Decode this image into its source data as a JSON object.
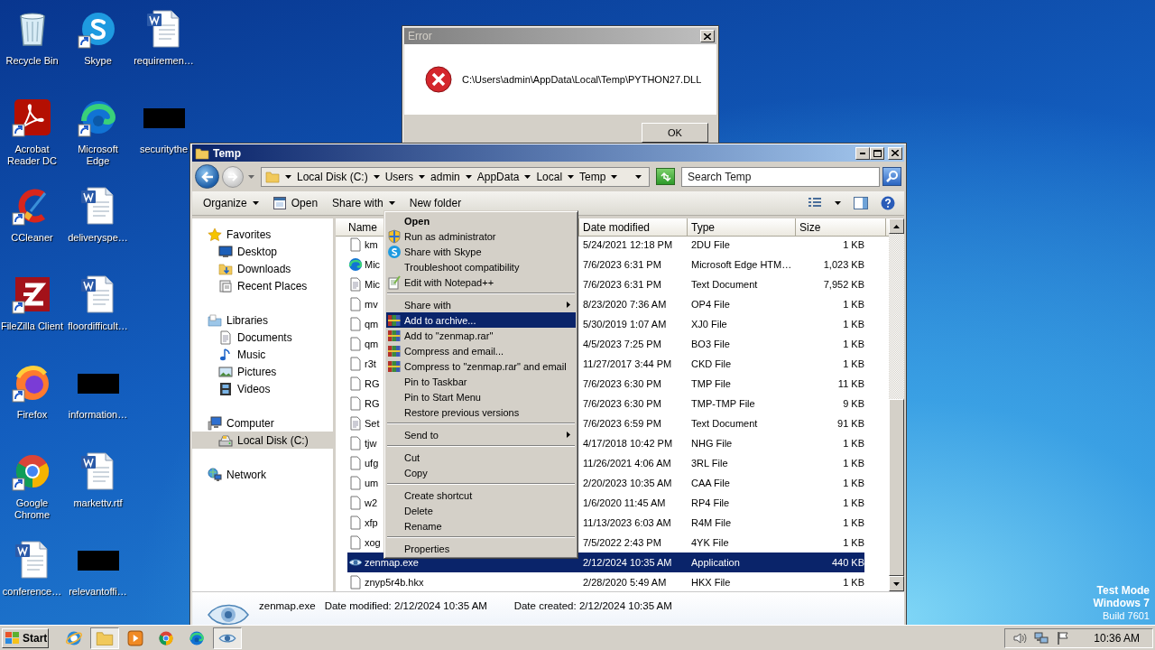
{
  "desktop": {
    "icons": [
      {
        "label": "Recycle Bin",
        "kind": "recycle",
        "shortcut": false
      },
      {
        "label": "Acrobat Reader DC",
        "kind": "acrobat",
        "shortcut": true
      },
      {
        "label": "CCleaner",
        "kind": "ccleaner",
        "shortcut": true
      },
      {
        "label": "FileZilla Client",
        "kind": "filezilla",
        "shortcut": true
      },
      {
        "label": "Firefox",
        "kind": "firefox",
        "shortcut": true
      },
      {
        "label": "Google Chrome",
        "kind": "chrome",
        "shortcut": true
      },
      {
        "label": "conference…",
        "kind": "word",
        "shortcut": false
      },
      {
        "label": "Skype",
        "kind": "skype",
        "shortcut": true
      },
      {
        "label": "Microsoft Edge",
        "kind": "edge",
        "shortcut": true
      },
      {
        "label": "deliveryspe…",
        "kind": "word",
        "shortcut": false
      },
      {
        "label": "floordifficult…",
        "kind": "word",
        "shortcut": false
      },
      {
        "label": "information…",
        "kind": "thumb",
        "shortcut": false
      },
      {
        "label": "markettv.rtf",
        "kind": "word",
        "shortcut": false
      },
      {
        "label": "relevantoffi…",
        "kind": "thumb",
        "shortcut": false
      },
      {
        "label": "requiremen…",
        "kind": "word",
        "shortcut": false
      },
      {
        "label": "securitythe",
        "kind": "thumb",
        "shortcut": false
      }
    ]
  },
  "error_dialog": {
    "title": "Error",
    "message": "C:\\Users\\admin\\AppData\\Local\\Temp\\PYTHON27.DLL",
    "button": "OK"
  },
  "explorer": {
    "title": "Temp",
    "address": [
      "Local Disk (C:)",
      "Users",
      "admin",
      "AppData",
      "Local",
      "Temp"
    ],
    "search": {
      "placeholder": "Search Temp"
    },
    "toolbar": [
      {
        "label": "Organize",
        "kind": "dropdown"
      },
      {
        "label": "Open",
        "kind": "icon"
      },
      {
        "label": "Share with",
        "kind": "dropdown"
      },
      {
        "label": "New folder",
        "kind": "plain"
      }
    ],
    "nav": [
      {
        "label": "Favorites",
        "kind": "star",
        "selected": false,
        "children": [
          {
            "label": "Desktop",
            "kind": "desktop",
            "selected": false
          },
          {
            "label": "Downloads",
            "kind": "downloads",
            "selected": false
          },
          {
            "label": "Recent Places",
            "kind": "recent",
            "selected": false
          }
        ]
      },
      {
        "label": "Libraries",
        "kind": "library",
        "selected": false,
        "children": [
          {
            "label": "Documents",
            "kind": "doc",
            "selected": false
          },
          {
            "label": "Music",
            "kind": "music",
            "selected": false
          },
          {
            "label": "Pictures",
            "kind": "pictures",
            "selected": false
          },
          {
            "label": "Videos",
            "kind": "videos",
            "selected": false
          }
        ]
      },
      {
        "label": "Computer",
        "kind": "computer",
        "selected": false,
        "children": [
          {
            "label": "Local Disk (C:)",
            "kind": "disk",
            "selected": true
          }
        ]
      },
      {
        "label": "Network",
        "kind": "network",
        "selected": false
      }
    ],
    "columns": [
      "Name",
      "Date modified",
      "Type",
      "Size"
    ],
    "files": [
      {
        "name": "km",
        "kind": "blank",
        "date": "5/24/2021 12:18 PM",
        "type": "2DU File",
        "size": "1 KB",
        "selected": false
      },
      {
        "name": "Mic",
        "kind": "edge",
        "date": "7/6/2023 6:31 PM",
        "type": "Microsoft Edge HTM…",
        "size": "1,023 KB",
        "selected": false
      },
      {
        "name": "Mic",
        "kind": "text",
        "date": "7/6/2023 6:31 PM",
        "type": "Text Document",
        "size": "7,952 KB",
        "selected": false
      },
      {
        "name": "mv",
        "kind": "blank",
        "date": "8/23/2020 7:36 AM",
        "type": "OP4 File",
        "size": "1 KB",
        "selected": false
      },
      {
        "name": "qm",
        "kind": "blank",
        "date": "5/30/2019 1:07 AM",
        "type": "XJ0 File",
        "size": "1 KB",
        "selected": false
      },
      {
        "name": "qm",
        "kind": "blank",
        "date": "4/5/2023 7:25 PM",
        "type": "BO3 File",
        "size": "1 KB",
        "selected": false
      },
      {
        "name": "r3t",
        "kind": "blank",
        "date": "11/27/2017 3:44 PM",
        "type": "CKD File",
        "size": "1 KB",
        "selected": false
      },
      {
        "name": "RG",
        "kind": "blank",
        "date": "7/6/2023 6:30 PM",
        "type": "TMP File",
        "size": "11 KB",
        "selected": false
      },
      {
        "name": "RG",
        "kind": "blank",
        "date": "7/6/2023 6:30 PM",
        "type": "TMP-TMP File",
        "size": "9 KB",
        "selected": false
      },
      {
        "name": "Set",
        "kind": "text",
        "date": "7/6/2023 6:59 PM",
        "type": "Text Document",
        "size": "91 KB",
        "selected": false
      },
      {
        "name": "tjw",
        "kind": "blank",
        "date": "4/17/2018 10:42 PM",
        "type": "NHG File",
        "size": "1 KB",
        "selected": false
      },
      {
        "name": "ufg",
        "kind": "blank",
        "date": "11/26/2021 4:06 AM",
        "type": "3RL File",
        "size": "1 KB",
        "selected": false
      },
      {
        "name": "um",
        "kind": "blank",
        "date": "2/20/2023 10:35 AM",
        "type": "CAA File",
        "size": "1 KB",
        "selected": false
      },
      {
        "name": "w2",
        "kind": "blank",
        "date": "1/6/2020 11:45 AM",
        "type": "RP4 File",
        "size": "1 KB",
        "selected": false
      },
      {
        "name": "xfp",
        "kind": "blank",
        "date": "11/13/2023 6:03 AM",
        "type": "R4M File",
        "size": "1 KB",
        "selected": false
      },
      {
        "name": "xog",
        "kind": "blank",
        "date": "7/5/2022 2:43 PM",
        "type": "4YK File",
        "size": "1 KB",
        "selected": false
      },
      {
        "name": "zenmap.exe",
        "kind": "exe",
        "date": "2/12/2024 10:35 AM",
        "type": "Application",
        "size": "440 KB",
        "selected": true
      },
      {
        "name": "znyp5r4b.hkx",
        "kind": "blank",
        "date": "2/28/2020 5:49 AM",
        "type": "HKX File",
        "size": "1 KB",
        "selected": false
      }
    ],
    "details": {
      "name": "zenmap.exe",
      "fields": [
        "Date modified: 2/12/2024 10:35 AM",
        "Date created: 2/12/2024 10:35 AM"
      ]
    }
  },
  "context_menu": [
    {
      "kind": "default",
      "label": "Open",
      "selected": false
    },
    {
      "kind": "shield",
      "label": "Run as administrator",
      "selected": false
    },
    {
      "kind": "skype",
      "label": "Share with Skype",
      "selected": false
    },
    {
      "kind": "plain",
      "label": "Troubleshoot compatibility",
      "selected": false
    },
    {
      "kind": "notepad",
      "label": "Edit with Notepad++",
      "selected": false
    },
    {
      "kind": "separator"
    },
    {
      "kind": "submenu",
      "label": "Share with",
      "selected": false
    },
    {
      "kind": "archive",
      "label": "Add to archive...",
      "selected": true
    },
    {
      "kind": "archive",
      "label": "Add to \"zenmap.rar\"",
      "selected": false
    },
    {
      "kind": "archive",
      "label": "Compress and email...",
      "selected": false
    },
    {
      "kind": "archive",
      "label": "Compress to \"zenmap.rar\" and email",
      "selected": false
    },
    {
      "kind": "plain",
      "label": "Pin to Taskbar",
      "selected": false
    },
    {
      "kind": "plain",
      "label": "Pin to Start Menu",
      "selected": false
    },
    {
      "kind": "plain",
      "label": "Restore previous versions",
      "selected": false
    },
    {
      "kind": "separator"
    },
    {
      "kind": "submenu",
      "label": "Send to",
      "selected": false
    },
    {
      "kind": "separator"
    },
    {
      "kind": "plain",
      "label": "Cut",
      "selected": false
    },
    {
      "kind": "plain",
      "label": "Copy",
      "selected": false
    },
    {
      "kind": "separator"
    },
    {
      "kind": "plain",
      "label": "Create shortcut",
      "selected": false
    },
    {
      "kind": "plain",
      "label": "Delete",
      "selected": false
    },
    {
      "kind": "plain",
      "label": "Rename",
      "selected": false
    },
    {
      "kind": "separator"
    },
    {
      "kind": "plain",
      "label": "Properties",
      "selected": false
    }
  ],
  "taskbar": {
    "start": "Start",
    "apps": [
      {
        "kind": "ie",
        "active": false
      },
      {
        "kind": "explorer",
        "active": true
      },
      {
        "kind": "media",
        "active": false
      },
      {
        "kind": "chrome",
        "active": false
      },
      {
        "kind": "edge",
        "active": false
      },
      {
        "kind": "zenmap",
        "active": true
      }
    ],
    "clock": "10:36 AM"
  },
  "watermark": [
    "Test Mode",
    "Windows 7",
    "Build 7601"
  ]
}
